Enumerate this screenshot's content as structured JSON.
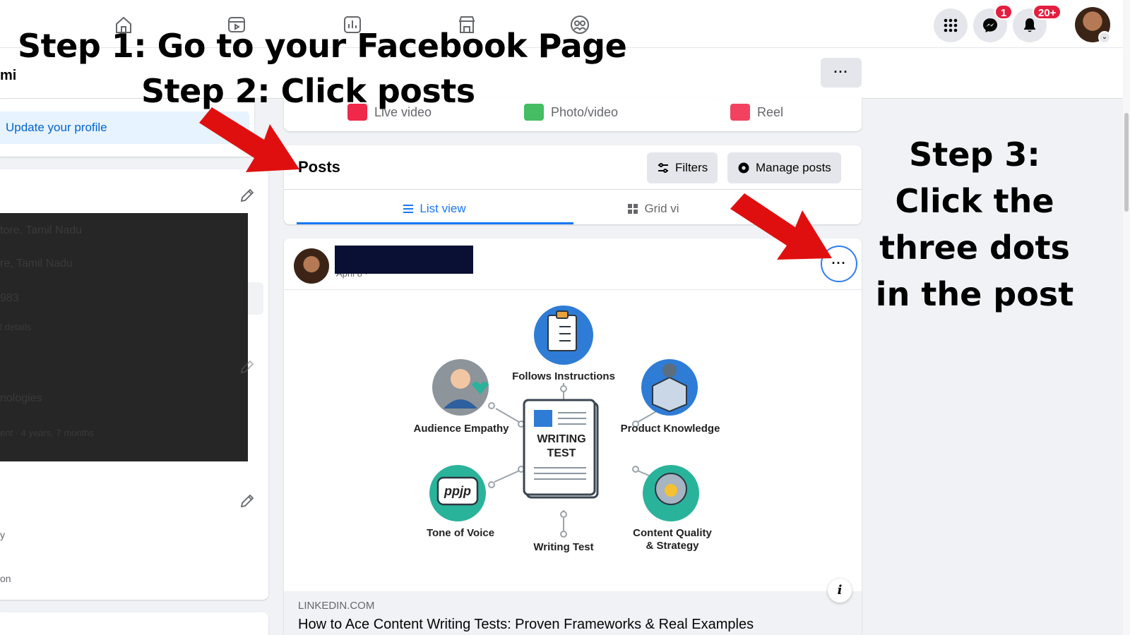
{
  "nav": {
    "icons": [
      "home-icon",
      "video-icon",
      "insights-icon",
      "marketplace-icon",
      "groups-icon"
    ],
    "right_icons": [
      "apps-grid-icon",
      "messenger-icon",
      "notifications-icon"
    ],
    "messenger_badge": "1",
    "notifications_badge": "20+"
  },
  "subheader": {
    "name_fragment": "mi",
    "more_label": "···"
  },
  "left": {
    "update_profile": "Update your profile",
    "lines": [
      "tore, Tamil Nadu",
      "re, Tamil Nadu",
      "983",
      "l details",
      "nologies",
      "ent · 4 years, 7 months"
    ],
    "bottom_lines": [
      "y",
      "on"
    ]
  },
  "composer": {
    "live_video": "Live video",
    "photo_video": "Photo/video",
    "reel": "Reel"
  },
  "posts": {
    "title": "Posts",
    "filters": "Filters",
    "manage": "Manage posts",
    "tab_list": "List view",
    "tab_grid": "Grid vi"
  },
  "post": {
    "date": "April 8 · ",
    "more_label": "···",
    "info_label": "i",
    "infographic": {
      "center": "WRITING\nTEST",
      "top": "Follows Instructions",
      "left_top": "Audience Empathy",
      "right_top": "Product Knowledge",
      "left_bottom": "Tone of Voice",
      "bottom": "Writing Test",
      "right_bottom": "Content Quality\n& Strategy",
      "bubble_text": "ppjp"
    },
    "link_domain": "LINKEDIN.COM",
    "link_title": "How to Ace Content Writing Tests: Proven Frameworks & Real Examples"
  },
  "annotations": {
    "step1": "Step 1: Go to your Facebook Page",
    "step2": "Step 2: Click posts",
    "step3": "Step 3: Click the three dots in the post"
  },
  "colors": {
    "accent": "#1877f2",
    "arrow": "#e00f0f",
    "badge": "#e41e3f"
  }
}
